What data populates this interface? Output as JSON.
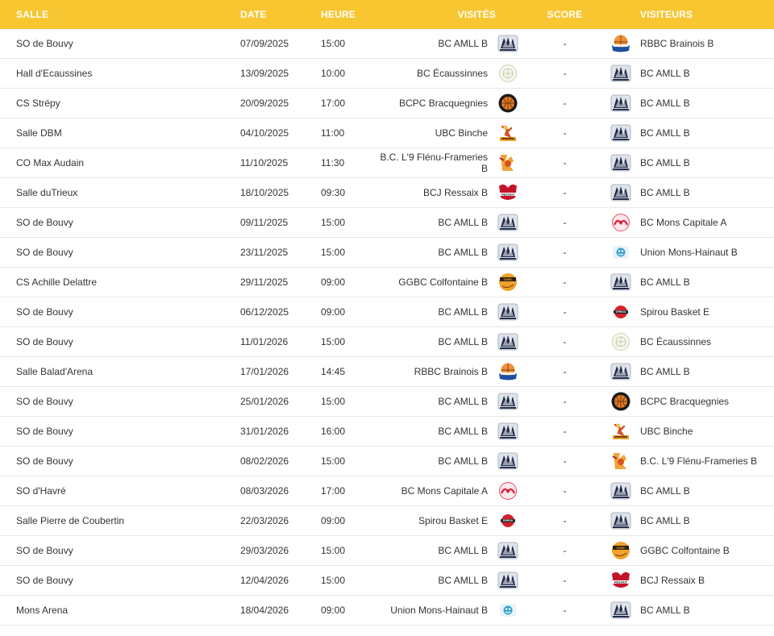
{
  "headers": {
    "salle": "SALLE",
    "date": "DATE",
    "heure": "HEURE",
    "visites": "VISITÉS",
    "score": "SCORE",
    "visiteurs": "VISITEURS"
  },
  "logo_icons": {
    "amll": "amll-logo-icon",
    "rbbc": "rbbc-logo-icon",
    "ecaussinnes": "ecaussinnes-logo-icon",
    "bcpc": "bcpc-logo-icon",
    "ubc": "ubc-binche-logo-icon",
    "flenu": "flenu-frameries-logo-icon",
    "ressaix": "ressaix-logo-icon",
    "mons": "mons-capitale-logo-icon",
    "union": "union-mons-hainaut-logo-icon",
    "ggbc": "ggbc-colfontaine-logo-icon",
    "spirou": "spirou-basket-logo-icon"
  },
  "colors": {
    "header_bg": "#f7c631",
    "header_text": "#ffffff",
    "row_border": "#e8e8e8"
  },
  "matches": [
    {
      "salle": "SO de Bouvy",
      "date": "07/09/2025",
      "heure": "15:00",
      "home": "BC AMLL B",
      "home_logo": "amll",
      "score": "-",
      "away": "RBBC Brainois B",
      "away_logo": "rbbc"
    },
    {
      "salle": "Hall d'Ecaussines",
      "date": "13/09/2025",
      "heure": "10:00",
      "home": "BC Écaussinnes",
      "home_logo": "ecaussinnes",
      "score": "-",
      "away": "BC AMLL B",
      "away_logo": "amll"
    },
    {
      "salle": "CS Strépy",
      "date": "20/09/2025",
      "heure": "17:00",
      "home": "BCPC Bracquegnies",
      "home_logo": "bcpc",
      "score": "-",
      "away": "BC AMLL B",
      "away_logo": "amll"
    },
    {
      "salle": "Salle DBM",
      "date": "04/10/2025",
      "heure": "11:00",
      "home": "UBC Binche",
      "home_logo": "ubc",
      "score": "-",
      "away": "BC AMLL B",
      "away_logo": "amll"
    },
    {
      "salle": "CO Max Audain",
      "date": "11/10/2025",
      "heure": "11:30",
      "home": "B.C. L'9 Flénu-Frameries B",
      "home_logo": "flenu",
      "score": "-",
      "away": "BC AMLL B",
      "away_logo": "amll",
      "tall": true
    },
    {
      "salle": "Salle duTrieux",
      "date": "18/10/2025",
      "heure": "09:30",
      "home": "BCJ Ressaix B",
      "home_logo": "ressaix",
      "score": "-",
      "away": "BC AMLL B",
      "away_logo": "amll"
    },
    {
      "salle": "SO de Bouvy",
      "date": "09/11/2025",
      "heure": "15:00",
      "home": "BC AMLL B",
      "home_logo": "amll",
      "score": "-",
      "away": "BC Mons Capitale A",
      "away_logo": "mons"
    },
    {
      "salle": "SO de Bouvy",
      "date": "23/11/2025",
      "heure": "15:00",
      "home": "BC AMLL B",
      "home_logo": "amll",
      "score": "-",
      "away": "Union Mons-Hainaut B",
      "away_logo": "union"
    },
    {
      "salle": "CS Achille Delattre",
      "date": "29/11/2025",
      "heure": "09:00",
      "home": "GGBC Colfontaine B",
      "home_logo": "ggbc",
      "score": "-",
      "away": "BC AMLL B",
      "away_logo": "amll"
    },
    {
      "salle": "SO de Bouvy",
      "date": "06/12/2025",
      "heure": "09:00",
      "home": "BC AMLL B",
      "home_logo": "amll",
      "score": "-",
      "away": "Spirou Basket E",
      "away_logo": "spirou"
    },
    {
      "salle": "SO de Bouvy",
      "date": "11/01/2026",
      "heure": "15:00",
      "home": "BC AMLL B",
      "home_logo": "amll",
      "score": "-",
      "away": "BC Écaussinnes",
      "away_logo": "ecaussinnes"
    },
    {
      "salle": "Salle Balad'Arena",
      "date": "17/01/2026",
      "heure": "14:45",
      "home": "RBBC Brainois B",
      "home_logo": "rbbc",
      "score": "-",
      "away": "BC AMLL B",
      "away_logo": "amll"
    },
    {
      "salle": "SO de Bouvy",
      "date": "25/01/2026",
      "heure": "15:00",
      "home": "BC AMLL B",
      "home_logo": "amll",
      "score": "-",
      "away": "BCPC Bracquegnies",
      "away_logo": "bcpc"
    },
    {
      "salle": "SO de Bouvy",
      "date": "31/01/2026",
      "heure": "16:00",
      "home": "BC AMLL B",
      "home_logo": "amll",
      "score": "-",
      "away": "UBC Binche",
      "away_logo": "ubc"
    },
    {
      "salle": "SO de Bouvy",
      "date": "08/02/2026",
      "heure": "15:00",
      "home": "BC AMLL B",
      "home_logo": "amll",
      "score": "-",
      "away": "B.C. L'9 Flénu-Frameries B",
      "away_logo": "flenu"
    },
    {
      "salle": "SO d'Havré",
      "date": "08/03/2026",
      "heure": "17:00",
      "home": "BC Mons Capitale A",
      "home_logo": "mons",
      "score": "-",
      "away": "BC AMLL B",
      "away_logo": "amll"
    },
    {
      "salle": "Salle Pierre de Coubertin",
      "date": "22/03/2026",
      "heure": "09:00",
      "home": "Spirou Basket E",
      "home_logo": "spirou",
      "score": "-",
      "away": "BC AMLL B",
      "away_logo": "amll"
    },
    {
      "salle": "SO de Bouvy",
      "date": "29/03/2026",
      "heure": "15:00",
      "home": "BC AMLL B",
      "home_logo": "amll",
      "score": "-",
      "away": "GGBC Colfontaine B",
      "away_logo": "ggbc"
    },
    {
      "salle": "SO de Bouvy",
      "date": "12/04/2026",
      "heure": "15:00",
      "home": "BC AMLL B",
      "home_logo": "amll",
      "score": "-",
      "away": "BCJ Ressaix B",
      "away_logo": "ressaix"
    },
    {
      "salle": "Mons Arena",
      "date": "18/04/2026",
      "heure": "09:00",
      "home": "Union Mons-Hainaut B",
      "home_logo": "union",
      "score": "-",
      "away": "BC AMLL B",
      "away_logo": "amll"
    }
  ]
}
